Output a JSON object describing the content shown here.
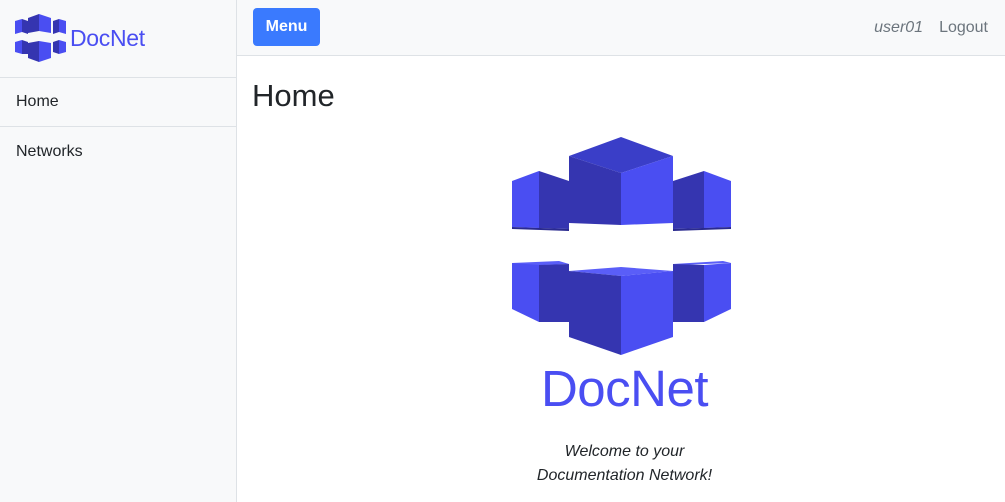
{
  "brand": {
    "name": "DocNet",
    "logo_icon": "docnet-cubes-logo"
  },
  "colors": {
    "brand": "#4a4ef2",
    "brand_dark": "#3535b0",
    "button": "#3a7afe"
  },
  "sidebar": {
    "items": [
      {
        "label": "Home"
      },
      {
        "label": "Networks"
      }
    ]
  },
  "topbar": {
    "menu_label": "Menu",
    "username": "user01",
    "logout_label": "Logout"
  },
  "main": {
    "title": "Home",
    "hero_brand": "DocNet",
    "welcome_line1": "Welcome to your",
    "welcome_line2": "Documentation Network!"
  }
}
